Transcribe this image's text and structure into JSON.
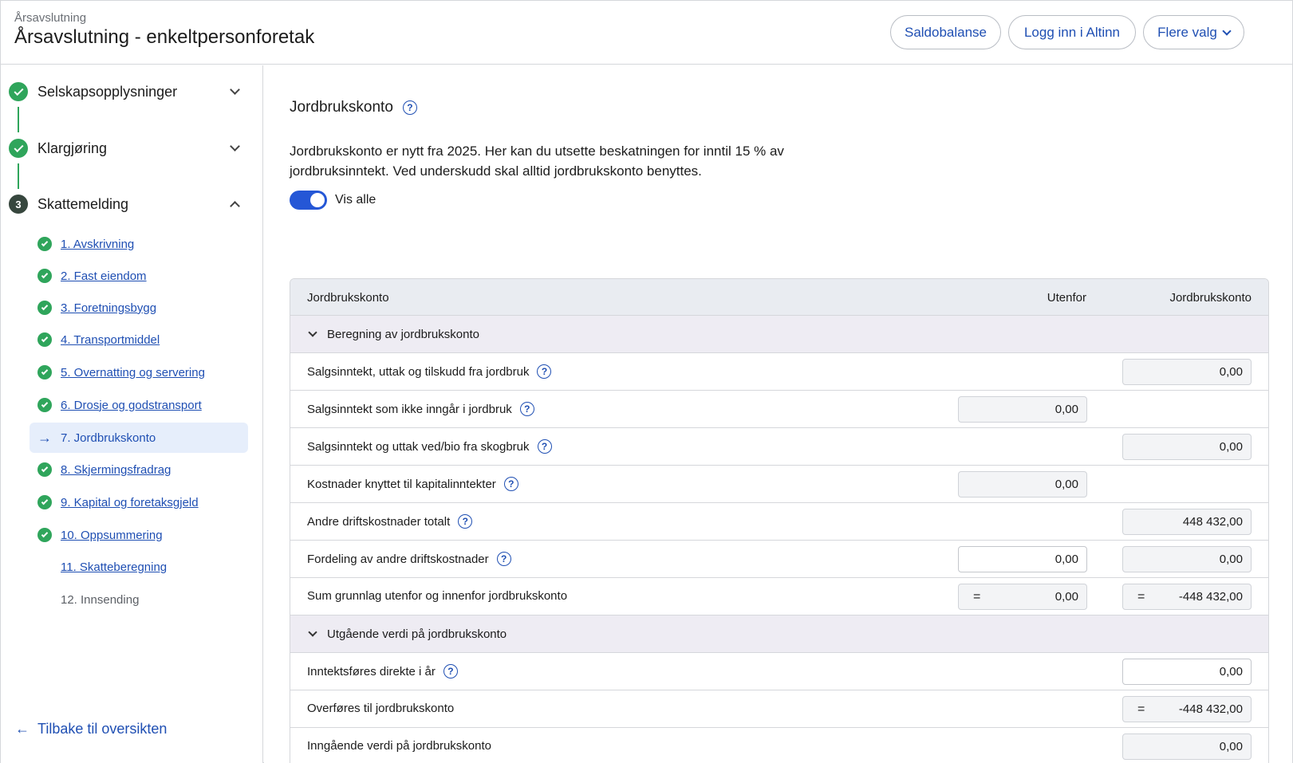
{
  "header": {
    "breadcrumb": "Årsavslutning",
    "title": "Årsavslutning - enkeltpersonforetak",
    "buttons": {
      "saldobalanse": "Saldobalanse",
      "altinn": "Logg inn i Altinn",
      "flere": "Flere valg"
    }
  },
  "sidebar": {
    "steps": [
      {
        "label": "Selskapsopplysninger"
      },
      {
        "label": "Klargjøring"
      },
      {
        "label": "Skattemelding",
        "number": "3"
      }
    ],
    "substeps": [
      {
        "label": "1. Avskrivning"
      },
      {
        "label": "2. Fast eiendom"
      },
      {
        "label": "3. Foretningsbygg"
      },
      {
        "label": "4. Transportmiddel"
      },
      {
        "label": "5. Overnatting og servering"
      },
      {
        "label": "6. Drosje og godstransport"
      },
      {
        "label": "7. Jordbrukskonto"
      },
      {
        "label": "8. Skjermingsfradrag"
      },
      {
        "label": "9. Kapital og foretaksgjeld"
      },
      {
        "label": "10. Oppsummering"
      },
      {
        "label": "11. Skatteberegning"
      },
      {
        "label": "12. Innsending"
      }
    ],
    "back_label": "Tilbake til oversikten"
  },
  "main": {
    "title": "Jordbrukskonto",
    "description": "Jordbrukskonto er nytt fra 2025. Her kan du utsette beskatningen for inntil 15 % av jordbruksinntekt. Ved underskudd skal alltid jordbrukskonto benyttes.",
    "toggle_label": "Vis alle",
    "table": {
      "headers": {
        "col1": "Jordbrukskonto",
        "col2": "Utenfor",
        "col3": "Jordbrukskonto"
      },
      "group1": "Beregning av jordbrukskonto",
      "rows1": [
        {
          "label": "Salgsinntekt, uttak og tilskudd fra jordbruk",
          "col3": "0,00"
        },
        {
          "label": "Salgsinntekt som ikke inngår i jordbruk",
          "col2": "0,00"
        },
        {
          "label": "Salgsinntekt og uttak ved/bio fra skogbruk",
          "col3": "0,00"
        },
        {
          "label": "Kostnader knyttet til kapitalinntekter",
          "col2": "0,00"
        },
        {
          "label": "Andre driftskostnader totalt",
          "col3": "448 432,00"
        },
        {
          "label": "Fordeling av andre driftskostnader",
          "col2": "0,00",
          "col3": "0,00"
        },
        {
          "label": "Sum grunnlag utenfor og innenfor jordbrukskonto",
          "col2": "0,00",
          "col3": "-448 432,00",
          "eq": "="
        }
      ],
      "group2": "Utgående verdi på jordbrukskonto",
      "rows2": [
        {
          "label": "Inntektsføres direkte i år",
          "col3": "0,00"
        },
        {
          "label": "Overføres til jordbrukskonto",
          "col3": "-448 432,00",
          "eq": "="
        },
        {
          "label": "Inngående verdi på jordbrukskonto",
          "col3": "0,00"
        }
      ]
    }
  },
  "colors": {
    "accent": "#1f4fb3",
    "success": "#2fa55b",
    "toggle": "#2557d6",
    "active_bg": "#e6eefb"
  }
}
